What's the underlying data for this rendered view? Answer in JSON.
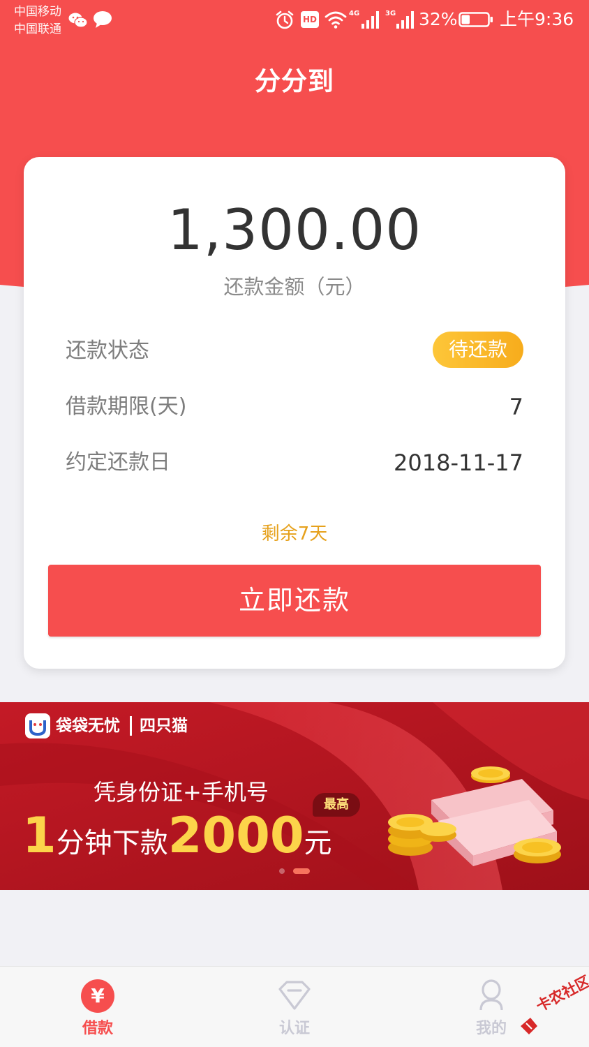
{
  "status_bar": {
    "carrier_1": "中国移动",
    "carrier_2": "中国联通",
    "icons": [
      "wechat-icon",
      "message-icon",
      "alarm-icon",
      "hd-badge",
      "wifi-icon",
      "signal-4g-icon",
      "signal-3g-icon",
      "battery-icon"
    ],
    "hd": "HD",
    "net_1": "4G",
    "net_2": "3G",
    "battery": "32%",
    "battery_level": 0.32,
    "time": "上午9:36"
  },
  "header": {
    "title": "分分到"
  },
  "repayment": {
    "amount": "1,300.00",
    "amount_label": "还款金额（元）",
    "rows": [
      {
        "label": "还款状态",
        "value": "待还款"
      },
      {
        "label": "借款期限(天)",
        "value": "7"
      },
      {
        "label": "约定还款日",
        "value": "2018-11-17"
      }
    ],
    "days_left": "剩余7天",
    "button_label": "立即还款"
  },
  "banner": {
    "brand_name": "袋袋无忧",
    "brand_partner": "四只猫",
    "line1": "凭身份证+手机号",
    "line2_num1": "1",
    "line2_text1": "分钟下款",
    "line2_num2": "2000",
    "line2_text2": "元",
    "badge": "最高",
    "slides": 2,
    "active_slide": 2
  },
  "bottom_nav": {
    "items": [
      {
        "label": "借款",
        "icon": "yen-icon",
        "active": true
      },
      {
        "label": "认证",
        "icon": "diamond-icon",
        "active": false
      },
      {
        "label": "我的",
        "icon": "user-icon",
        "active": false
      }
    ]
  },
  "watermark": {
    "text": "卡农社区",
    "icon": "kanong-logo-icon"
  },
  "colors": {
    "primary_red": "#f64e4e",
    "badge_yellow": "#fdc639",
    "days_left_orange": "#e6a11c",
    "banner_red": "#b3141f",
    "banner_gold": "#fcd44a"
  }
}
